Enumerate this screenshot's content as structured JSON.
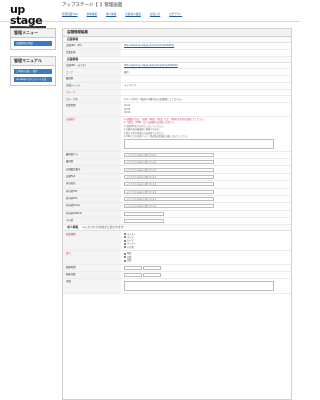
{
  "header": {
    "logo_text": "up stage",
    "logo_sub": "アップステージ",
    "app_title": "アップステージ【",
    "app_title_suffix": "】管理画面",
    "nav": [
      "管理画面TOP",
      "基本情報",
      "求人情報",
      "応募者の確認",
      "お知らせ",
      "ログアウト"
    ]
  },
  "sidebar": {
    "menu_title": "管理メニュー",
    "menu_items": [
      "店舗情報の登録"
    ],
    "manual_title": "管理マニュアル",
    "manual_items": [
      "ご利用の流れ・操作",
      "up stage マネジメント方法"
    ]
  },
  "main": {
    "panel_title": "店舗情報編集",
    "section_base": "店舗情報",
    "url_label": "店舗URL（PC）",
    "url_value": "http://www.up-stage.jp/shop/shop000000/",
    "type_label": "営業形態",
    "section_detail": "店舗情報",
    "url2_label": "店舗URL（スマホ）",
    "url2_value": "http://www.up-stage.jp/sp/shop/shop000000/",
    "area_label": "エリア",
    "area_value": "東京",
    "station_label": "最寄駅",
    "genre_label": "店舗ジャンル",
    "genre_value": "キャバクラ",
    "group_label": "グループ",
    "group_value": "グループ内で一覧表示可能なものを選択してください。",
    "group2_label": "グループ名",
    "hours_label": "営業時間",
    "hours_values": [
      "00:00",
      "00:00",
      "00:00"
    ],
    "pr_label": "店舗紹介",
    "pr_notes": [
      "1.店舗紹介文は、「必須」「時給」「保証」など、具体的な条件を記載してください。",
      "2.「電話」「LINE」などの連絡先は記載できません。",
      "3.全角800文字以内で入力してください。",
      "4.記載内容は審査後に掲載されます。",
      "5.絵文字等の特殊記号は使用できません。",
      "6.URLなどの外部リンク、他店舗の情報は記載しないでください。"
    ],
    "fields": [
      {
        "label": "最寄駅から",
        "placeholder": "入力された内容が公開されます"
      },
      {
        "label": "最寄駅",
        "placeholder": "入力された内容が公開されます"
      },
      {
        "label": "店舗電話番号",
        "placeholder": "入力された内容が公開されます"
      },
      {
        "label": "店舗FAX",
        "placeholder": "入力された内容が公開されます"
      },
      {
        "label": "担当者名",
        "placeholder": "入力された内容が公開されます"
      },
      {
        "label": "担当者TEL",
        "placeholder": "入力された内容が公開されます"
      },
      {
        "label": "担当者FAX",
        "placeholder": "入力された内容が公開されます"
      },
      {
        "label": "担当者Email",
        "placeholder": "入力された内容が公開されます"
      },
      {
        "label": "担当者LINE ID",
        "placeholder": ""
      },
      {
        "label": "その他",
        "placeholder": ""
      }
    ],
    "section_recruit": "求人情報",
    "recruit_note": "※入力された内容が公開されます",
    "job_label": "募集職種",
    "job_options": [
      "キャスト",
      "ホール",
      "ヘルプ",
      "キッチン",
      "その他"
    ],
    "salary_label": "給与",
    "salary_options": [
      "時給",
      "日給",
      "月給"
    ],
    "select_label1": "勤務時間",
    "select_label2": "勤務日数",
    "select_label3": "待遇"
  }
}
